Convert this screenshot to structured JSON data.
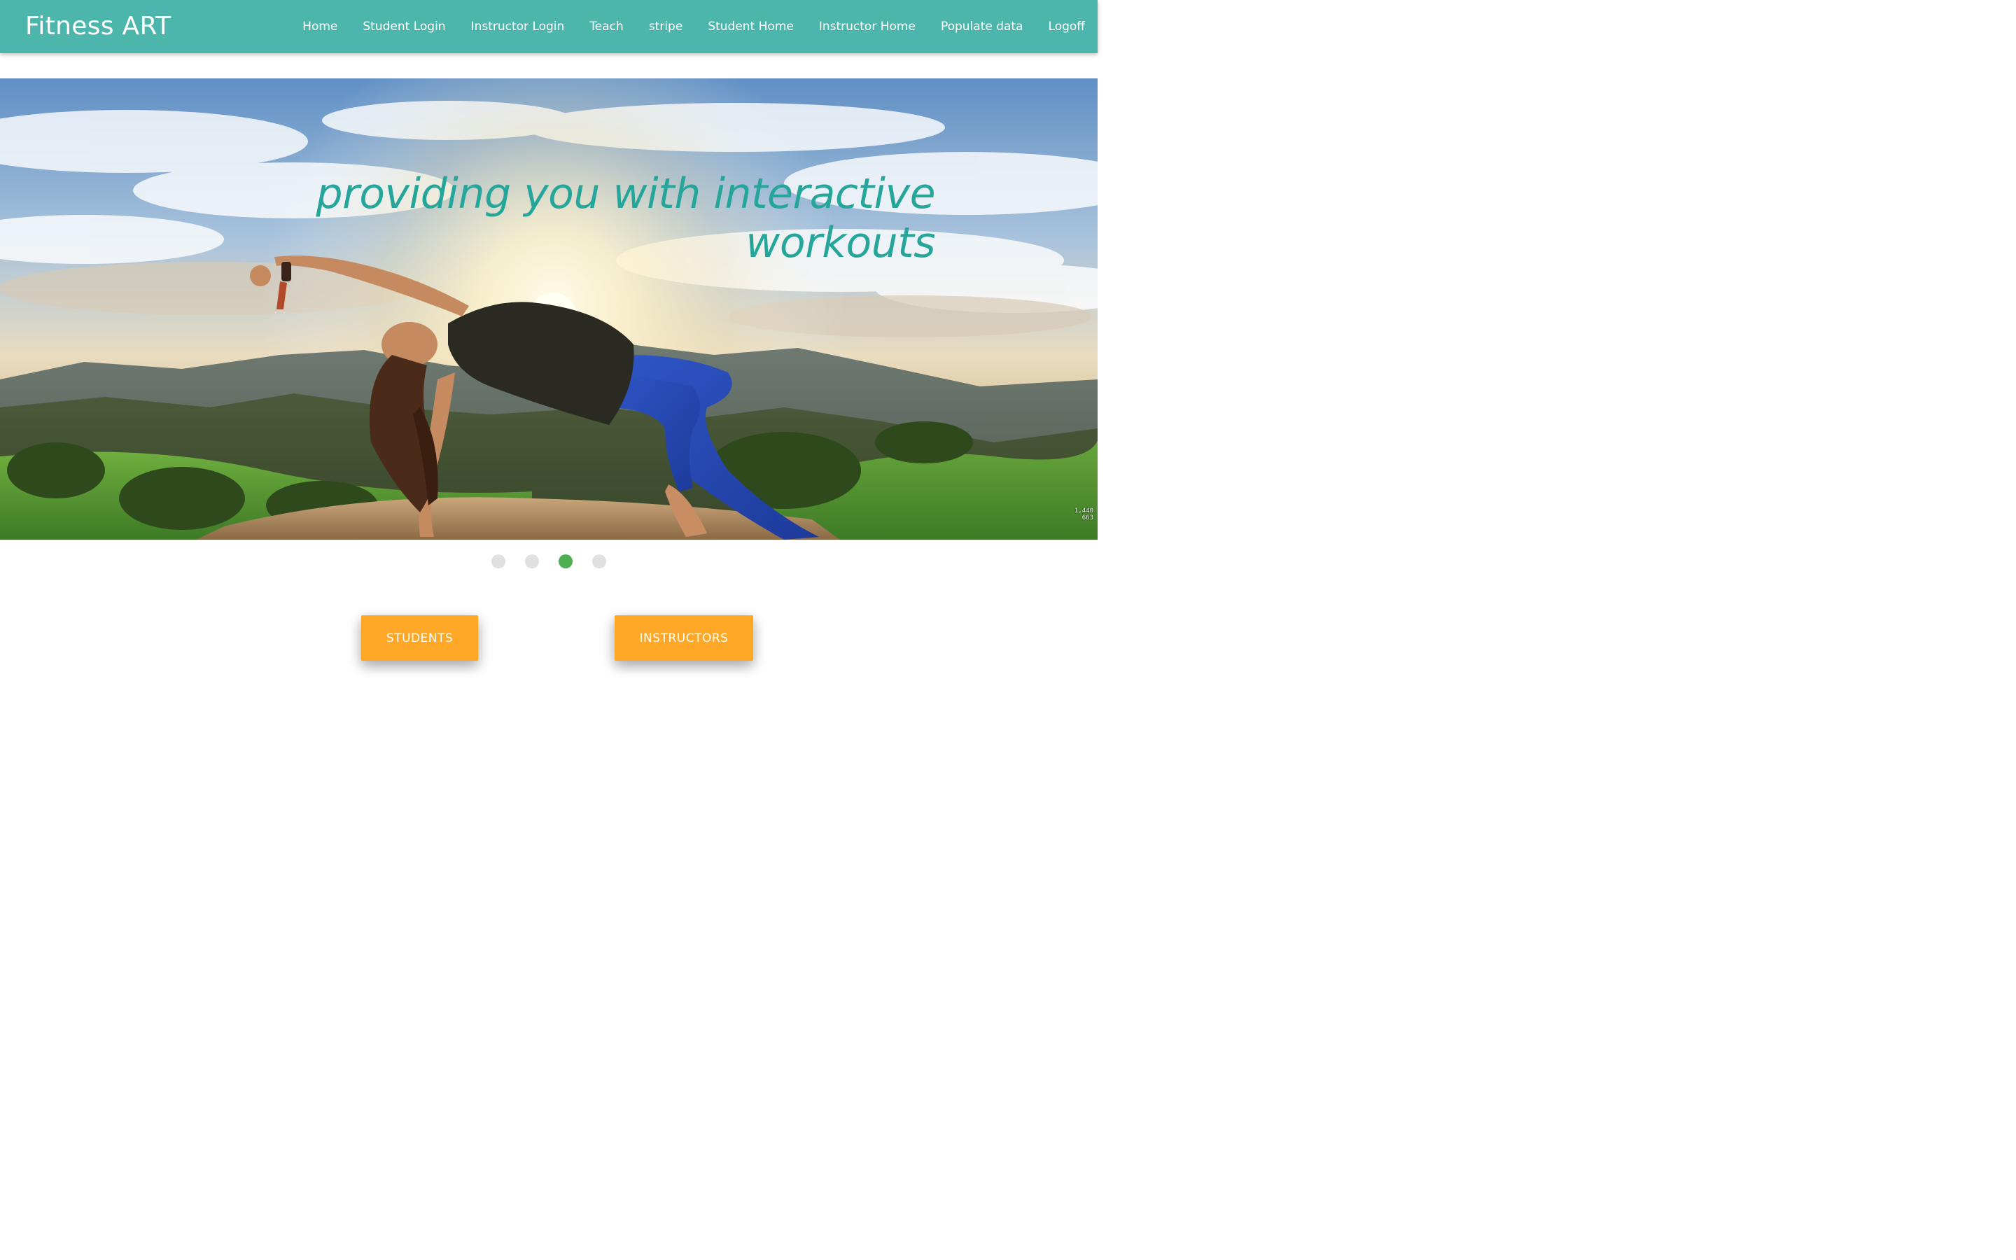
{
  "navbar": {
    "brand": "Fitness ART",
    "links": [
      "Home",
      "Student Login",
      "Instructor Login",
      "Teach",
      "stripe",
      "Student Home",
      "Instructor Home",
      "Populate data",
      "Logoff"
    ],
    "background_color": "#4db6ac"
  },
  "slider": {
    "caption_line1": "providing you with interactive",
    "caption_line2": "workouts",
    "caption_color": "#26a69a",
    "image_stamp_line1": "1,440",
    "image_stamp_line2": "663",
    "indicator_count": 4,
    "active_indicator": 3,
    "active_indicator_color": "#4caf50"
  },
  "actions": {
    "students_label": "STUDENTS",
    "instructors_label": "INSTRUCTORS",
    "button_color": "#ffa726"
  }
}
